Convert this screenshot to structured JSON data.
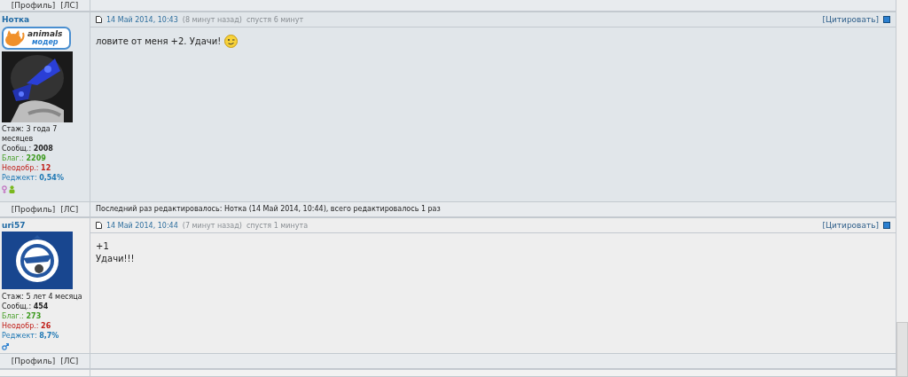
{
  "top_footer": {
    "links": [
      "[Профиль]",
      "[ЛС]"
    ]
  },
  "posts": [
    {
      "author": "Нотка",
      "badge": {
        "line1": "animals",
        "line2": "модер"
      },
      "avatar": {
        "kind": "picture"
      },
      "stats": [
        {
          "kind": "plain",
          "label": "Стаж: 3 года 7 месяцев"
        },
        {
          "kind": "plain",
          "label": "Сообщ.:",
          "value": "2008"
        },
        {
          "kind": "good",
          "label": "Благ.:",
          "value": "2209"
        },
        {
          "kind": "bad",
          "label": "Неодобр.:",
          "value": "12"
        },
        {
          "kind": "reject",
          "label": "Реджект:",
          "value": "0,54%"
        }
      ],
      "icons": [
        {
          "kind": "female"
        },
        {
          "kind": "person"
        }
      ],
      "date": "14 Май 2014, 10:43",
      "ago": "(8 минут назад)",
      "after": "спустя 6 минут",
      "quote": "[Цитировать]",
      "body": [
        "ловите от меня +2. Удачи!"
      ],
      "smiley": true,
      "links": [
        "[Профиль]",
        "[ЛС]"
      ],
      "edit_note": "Последний раз редактировалось: Нотка (14 Май 2014, 10:44), всего редактировалось 1 раз"
    },
    {
      "author": "uri57",
      "avatar": {
        "kind": "picture"
      },
      "stats": [
        {
          "kind": "plain",
          "label": "Стаж: 5 лет 4 месяца"
        },
        {
          "kind": "plain",
          "label": "Сообщ.:",
          "value": "454"
        },
        {
          "kind": "good",
          "label": "Благ.:",
          "value": "273"
        },
        {
          "kind": "bad",
          "label": "Неодобр.:",
          "value": "26"
        },
        {
          "kind": "reject",
          "label": "Реджект:",
          "value": "8,7%"
        }
      ],
      "icons": [
        {
          "kind": "male"
        }
      ],
      "date": "14 Май 2014, 10:44",
      "ago": "(7 минут назад)",
      "after": "спустя 1 минута",
      "quote": "[Цитировать]",
      "body": [
        "+1",
        "Удачи!!!"
      ],
      "smiley": false,
      "links": [
        "[Профиль]",
        "[ЛС]"
      ]
    }
  ]
}
